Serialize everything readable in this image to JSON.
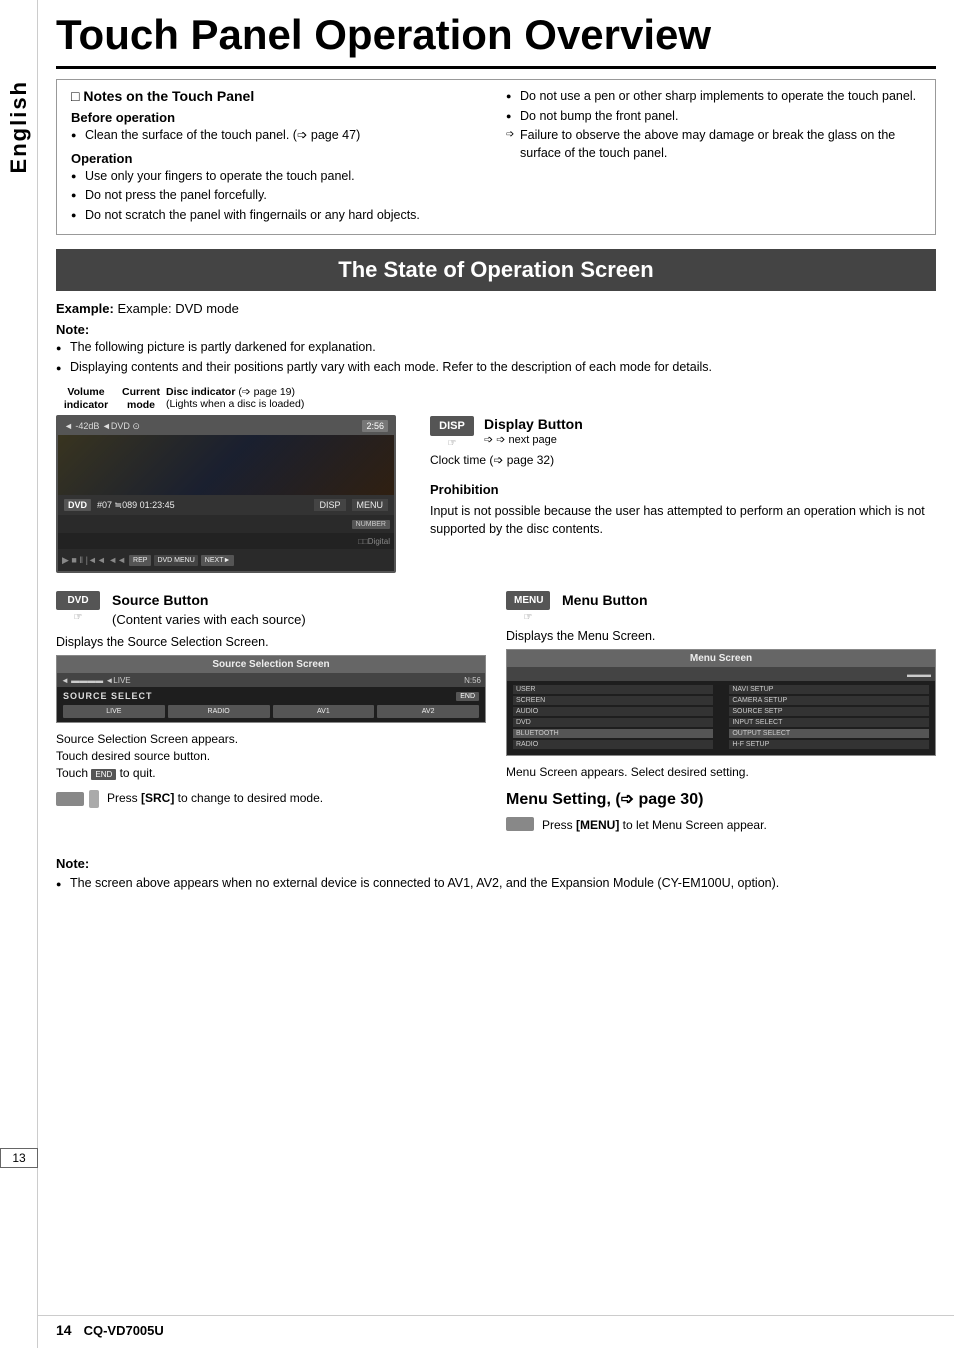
{
  "page": {
    "title": "Touch Panel Operation Overview",
    "sidebar_lang": "English",
    "sidebar_page": "13",
    "footer_page": "14",
    "footer_model": "CQ-VD7005U"
  },
  "notes": {
    "title": "Notes on the Touch Panel",
    "col1": {
      "before_title": "Before operation",
      "before_items": [
        "Clean the surface of the touch panel.  (➩ page 47)"
      ],
      "op_title": "Operation",
      "op_items": [
        "Use only your fingers to operate the touch panel.",
        "Do not press the panel forcefully.",
        "Do not scratch the panel with fingernails or any hard objects."
      ]
    },
    "col2": {
      "items": [
        "Do not use a pen or other sharp implements to operate the touch panel.",
        "Do not bump the front panel."
      ],
      "arrow_item": "Failure to observe the above may damage or break the glass on the surface of the touch panel."
    }
  },
  "state_section": {
    "title": "The State of Operation Screen",
    "example": "Example: DVD mode",
    "note_title": "Note:",
    "note_items": [
      "The following picture is partly darkened for explanation.",
      "Displaying contents and their positions partly vary with each mode. Refer to the description of each mode for details."
    ]
  },
  "diagram": {
    "callouts": {
      "volume": "Volume\nindicator",
      "current": "Current\nmode",
      "disc": "Disc indicator (➩ page 19)\n(Lights when a disc is loaded)"
    },
    "screen": {
      "topbar_left": "◄ -42dB ◄DVD ⊙",
      "topbar_right": "2:56",
      "info_row": "DVD   #07  ≒089  01:23:45",
      "disp_btn": "DISP",
      "menu_btn": "MENU",
      "number_btn": "NUMBER",
      "digital_label": "DDDigital",
      "next_btn": "NEXT►",
      "rep_btn": "REP"
    },
    "display_button": {
      "icon": "DISP",
      "title": "Display Button",
      "ref": "➩ next page"
    },
    "clock_time": "Clock time (➩ page 32)",
    "prohibition": {
      "title": "Prohibition",
      "text": "Input is not possible because the user has attempted to perform an operation which is not supported by the disc contents."
    }
  },
  "source_section": {
    "dvd_btn": "DVD",
    "source_btn_title": "Source Button",
    "source_btn_sub": "(Content varies with each source)",
    "displays_text": "Displays the Source Selection Screen.",
    "screen_title": "Source Selection Screen",
    "screen_header_text": "SOURCE SELECT",
    "screen_end_btn": "END",
    "screen_btns": [
      "LIVE",
      "RADIO",
      "AV1",
      "AV2"
    ],
    "appears_text": "Source Selection Screen appears.\nTouch desired source button.\nTouch",
    "appears_end": "to quit.",
    "hint_text": "Press [SRC] to change to desired mode."
  },
  "menu_section": {
    "menu_btn": "MENU",
    "menu_btn_title": "Menu Button",
    "displays_text": "Displays the Menu Screen.",
    "screen_title": "Menu Screen",
    "menu_rows": [
      [
        "USER",
        "NAVI SETUP"
      ],
      [
        "SCREEN",
        "CAMERA SETUP"
      ],
      [
        "AUDIO",
        "SOURCE SETP"
      ],
      [
        "DVD",
        "INPUT SELECT"
      ],
      [
        "BLUETOOTH",
        "OUTPUT SELECT"
      ],
      [
        "RADIO",
        "H-F SETUP"
      ]
    ],
    "appears_text": "Menu Screen appears. Select desired setting.",
    "setting_text": "Menu Setting, (➩ page 30)",
    "hint_text": "Press [MENU] to let Menu Screen appear."
  },
  "bottom_note": {
    "title": "Note:",
    "items": [
      "The screen above appears when no external device is connected to AV1, AV2, and the Expansion Module (CY-EM100U, option)."
    ]
  }
}
